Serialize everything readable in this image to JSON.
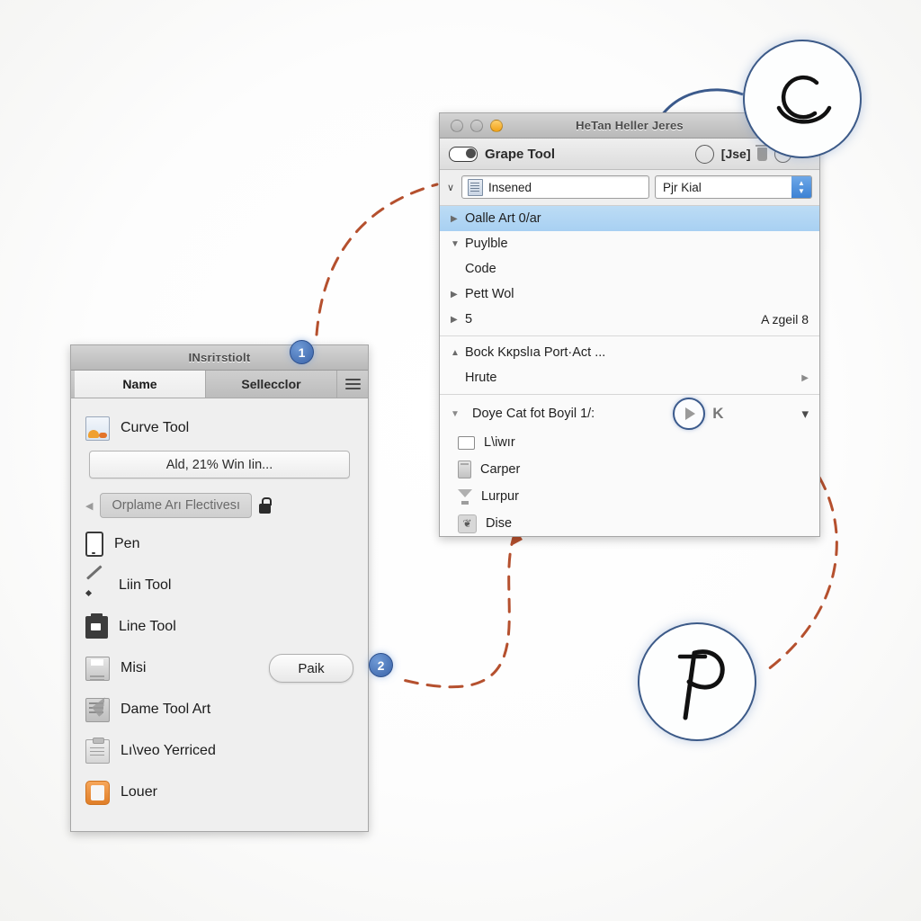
{
  "right_window": {
    "title": "HeTan Heller Jeres",
    "toolbar": {
      "tool_label": "Grape Tool",
      "use_label": "[Jse]",
      "toggle_icon": "toggle-switch-icon",
      "circle_icon": "circle-outline-icon",
      "trash_icon": "trash-icon",
      "clock_icon": "clock-icon",
      "more_icon": "more-dots-icon"
    },
    "field_row": {
      "chevron": "∨",
      "doc_icon": "document-icon",
      "input_value": "Insened",
      "select_value": "Pjr Kial"
    },
    "list": [
      {
        "label": "Oalle Art 0/ar",
        "marker": "▶",
        "selected": true,
        "right": ""
      },
      {
        "label": "Puylble",
        "marker": "▼",
        "selected": false,
        "right": ""
      },
      {
        "label": "Code",
        "marker": "",
        "selected": false,
        "right": ""
      },
      {
        "label": "Pett Wol",
        "marker": "▶",
        "selected": false,
        "right": ""
      },
      {
        "label": "5",
        "marker": "▶",
        "selected": false,
        "right": "A zgeil 8"
      }
    ],
    "list2": [
      {
        "label": "Bock Kĸpslıa Port·Act ...",
        "marker": "▲",
        "arrow": false
      },
      {
        "label": "Hrute",
        "marker": "",
        "arrow": true
      }
    ],
    "section": {
      "header": "Doye Cat fot Boyil  1/:",
      "header_marker": "▼",
      "play_icon": "play-button-icon",
      "k_glyph": "K",
      "collapse_icon": "chevron-down-icon",
      "items": [
        {
          "label": "L\\iwır",
          "icon": "checkbox-icon"
        },
        {
          "label": "Carper",
          "icon": "battery-icon"
        },
        {
          "label": "Lurpur",
          "icon": "funnel-icon"
        },
        {
          "label": "Dise",
          "icon": "apple-icon"
        }
      ]
    }
  },
  "left_window": {
    "title": "INsriтstiolt",
    "tabs": [
      {
        "label": "Name",
        "active": true
      },
      {
        "label": "Sellecclor",
        "active": false
      }
    ],
    "menu_icon": "hamburger-menu-icon",
    "header_item": {
      "label": "Curve Tool",
      "icon": "photo-icon"
    },
    "wide_button": "Ald, 21% Win Iin...",
    "sub_row": {
      "left_arrow": "◀",
      "pill_label": "Orplame Arı Flectivesı",
      "lock_icon": "lock-icon"
    },
    "items": [
      {
        "label": "Pen",
        "icon": "phone-icon",
        "button": ""
      },
      {
        "label": "Liin Tool",
        "icon": "pencil-icon",
        "button": ""
      },
      {
        "label": "Line Tool",
        "icon": "printer-icon",
        "button": ""
      },
      {
        "label": "Misi",
        "icon": "floppy-icon",
        "button": "Paik"
      },
      {
        "label": "Dame Tool Art",
        "icon": "note-icon",
        "button": ""
      },
      {
        "label": "Lı\\veo Yerriced",
        "icon": "clipboard-icon",
        "button": ""
      },
      {
        "label": "Louer",
        "icon": "layer-icon",
        "button": ""
      }
    ]
  },
  "callouts": {
    "badge_one": "1",
    "badge_two": "2",
    "circle_top_glyph": "C",
    "circle_top_name": "c-glyph-callout",
    "circle_bottom_glyph": "P",
    "circle_bottom_name": "p-glyph-callout"
  },
  "colors": {
    "accent_blue": "#3a63a8",
    "selection_blue": "#a8d0f2",
    "annotation_orange": "#b5502e",
    "callout_ring": "#3c5a88",
    "orange_icon": "#e07e28"
  }
}
